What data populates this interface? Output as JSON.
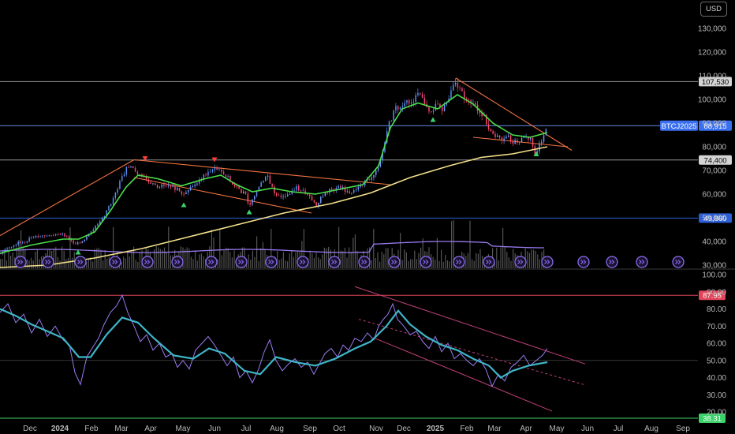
{
  "currency_button": "USD",
  "colors": {
    "background": "#000000",
    "ma_fast": "#4ade4a",
    "ma_slow": "#f3e08a",
    "trendline": "#ff7a45",
    "rsi": "#9a7af0",
    "rsi_ma": "#3fb5c8",
    "channel": "#c0407a",
    "up_marker": "#3bd26a",
    "down_marker": "#ff3b3b",
    "volume": "#9a9a9a",
    "event_badge": "#8a6cf0",
    "level_107530": "#d4d4d4",
    "level_88870": "#d4d4d4",
    "level_74400": "#d4d4d4",
    "level_49860": "#2d5fd8",
    "ticker": "#3a6ff0",
    "rsi_level_87": "#e0455a",
    "rsi_level_38": "#3bd26a"
  },
  "chart_data": [
    {
      "type": "candlestick",
      "symbol_label": "BTCJ2025",
      "currency": "USD",
      "ylim": [
        30000,
        135000
      ],
      "y_ticks": [
        "130,000",
        "120,000",
        "110,000",
        "100,000",
        "90,000",
        "80,000",
        "70,000",
        "60,000",
        "50,000",
        "40,000",
        "30,000"
      ],
      "y_tick_values": [
        130000,
        120000,
        110000,
        100000,
        90000,
        80000,
        70000,
        60000,
        50000,
        40000,
        30000
      ],
      "x_labels": [
        "Dec",
        "2024",
        "Feb",
        "Mar",
        "Apr",
        "May",
        "Jun",
        "Jul",
        "Aug",
        "Sep",
        "Oct",
        "Nov",
        "Dec",
        "2025",
        "Feb",
        "Mar",
        "Apr",
        "May",
        "Jun",
        "Jul",
        "Aug",
        "Sep"
      ],
      "close_path": [
        [
          0,
          35000
        ],
        [
          10,
          37500
        ],
        [
          20,
          39000
        ],
        [
          30,
          40000
        ],
        [
          40,
          41500
        ],
        [
          50,
          42500
        ],
        [
          60,
          42000
        ],
        [
          70,
          42500
        ],
        [
          80,
          43000
        ],
        [
          90,
          40000
        ],
        [
          100,
          39000
        ],
        [
          110,
          42000
        ],
        [
          120,
          46000
        ],
        [
          130,
          50000
        ],
        [
          140,
          56000
        ],
        [
          150,
          64000
        ],
        [
          158,
          70000
        ],
        [
          165,
          72000
        ],
        [
          172,
          70000
        ],
        [
          180,
          67000
        ],
        [
          190,
          64500
        ],
        [
          200,
          63000
        ],
        [
          210,
          64000
        ],
        [
          220,
          63000
        ],
        [
          230,
          60000
        ],
        [
          238,
          61000
        ],
        [
          245,
          64000
        ],
        [
          255,
          67000
        ],
        [
          265,
          69000
        ],
        [
          272,
          71000
        ],
        [
          280,
          70000
        ],
        [
          290,
          66500
        ],
        [
          300,
          62500
        ],
        [
          310,
          60000
        ],
        [
          316,
          55000
        ],
        [
          322,
          60000
        ],
        [
          330,
          65000
        ],
        [
          338,
          67500
        ],
        [
          345,
          62000
        ],
        [
          355,
          58000
        ],
        [
          365,
          60000
        ],
        [
          375,
          62500
        ],
        [
          385,
          62000
        ],
        [
          393,
          58000
        ],
        [
          400,
          55000
        ],
        [
          410,
          60000
        ],
        [
          420,
          62000
        ],
        [
          430,
          63000
        ],
        [
          440,
          61000
        ],
        [
          450,
          62000
        ],
        [
          460,
          64500
        ],
        [
          468,
          66000
        ],
        [
          475,
          69000
        ],
        [
          483,
          74000
        ],
        [
          488,
          84000
        ],
        [
          493,
          90000
        ],
        [
          500,
          96000
        ],
        [
          508,
          98000
        ],
        [
          515,
          100000
        ],
        [
          522,
          98000
        ],
        [
          530,
          104000
        ],
        [
          537,
          98000
        ],
        [
          545,
          95000
        ],
        [
          552,
          97500
        ],
        [
          560,
          96000
        ],
        [
          568,
          100000
        ],
        [
          575,
          106000
        ],
        [
          582,
          104000
        ],
        [
          590,
          100000
        ],
        [
          598,
          98000
        ],
        [
          605,
          96000
        ],
        [
          612,
          93000
        ],
        [
          620,
          88000
        ],
        [
          628,
          84000
        ],
        [
          635,
          83000
        ],
        [
          642,
          85000
        ],
        [
          650,
          82000
        ],
        [
          658,
          83000
        ],
        [
          665,
          85000
        ],
        [
          672,
          83500
        ],
        [
          677,
          77000
        ],
        [
          682,
          80000
        ],
        [
          688,
          85000
        ],
        [
          694,
          88000
        ]
      ],
      "ma_fast_path": [
        [
          0,
          35000
        ],
        [
          40,
          38500
        ],
        [
          80,
          41000
        ],
        [
          100,
          41000
        ],
        [
          120,
          44000
        ],
        [
          140,
          53000
        ],
        [
          160,
          63000
        ],
        [
          175,
          68000
        ],
        [
          200,
          66500
        ],
        [
          230,
          63500
        ],
        [
          260,
          66500
        ],
        [
          280,
          68000
        ],
        [
          300,
          64000
        ],
        [
          320,
          61000
        ],
        [
          345,
          62500
        ],
        [
          370,
          61000
        ],
        [
          400,
          60000
        ],
        [
          430,
          62000
        ],
        [
          460,
          64000
        ],
        [
          480,
          72000
        ],
        [
          495,
          88000
        ],
        [
          510,
          96000
        ],
        [
          530,
          98500
        ],
        [
          555,
          96000
        ],
        [
          580,
          102000
        ],
        [
          600,
          98000
        ],
        [
          625,
          90000
        ],
        [
          650,
          85000
        ],
        [
          672,
          84000
        ],
        [
          694,
          86000
        ]
      ],
      "ma_slow_path": [
        [
          0,
          29000
        ],
        [
          60,
          30000
        ],
        [
          120,
          33000
        ],
        [
          180,
          37000
        ],
        [
          240,
          42000
        ],
        [
          300,
          47000
        ],
        [
          360,
          52000
        ],
        [
          420,
          56000
        ],
        [
          470,
          60500
        ],
        [
          520,
          67000
        ],
        [
          570,
          72000
        ],
        [
          610,
          75500
        ],
        [
          650,
          77000
        ],
        [
          694,
          80000
        ]
      ],
      "horizontal_levels": [
        {
          "label": "107,530",
          "value": 107530
        },
        {
          "label": "88,870",
          "value": 88870
        },
        {
          "label": "74,400",
          "value": 74400
        },
        {
          "label": "49,860",
          "value": 49860
        }
      ],
      "current_price": {
        "label": "88,915",
        "value": 88915
      },
      "trendlines": [
        {
          "x": [
            0,
            170
          ],
          "y": [
            42500,
            74500
          ]
        },
        {
          "x": [
            170,
            495
          ],
          "y": [
            74500,
            64000
          ]
        },
        {
          "x": [
            170,
            395
          ],
          "y": [
            67000,
            52000
          ]
        },
        {
          "x": [
            578,
            725
          ],
          "y": [
            109000,
            78500
          ]
        },
        {
          "x": [
            600,
            720
          ],
          "y": [
            84000,
            80000
          ]
        }
      ],
      "markers": [
        {
          "type": "up",
          "x": 99,
          "price": 35500
        },
        {
          "type": "down",
          "x": 184,
          "price": 75000
        },
        {
          "type": "down",
          "x": 272,
          "price": 74500
        },
        {
          "type": "up",
          "x": 233,
          "price": 55500
        },
        {
          "type": "up",
          "x": 316,
          "price": 52500
        },
        {
          "type": "up",
          "x": 549,
          "price": 91500
        },
        {
          "type": "up",
          "x": 680,
          "price": 77000
        }
      ],
      "event_badges_x": [
        26,
        61,
        102,
        146,
        187,
        225,
        268,
        306,
        344,
        384,
        424,
        462,
        500,
        540,
        582,
        620,
        660,
        694,
        740,
        776,
        814,
        860
      ]
    },
    {
      "type": "line",
      "indicator": "RSI",
      "ylim": [
        20,
        100
      ],
      "y_ticks": [
        "100.00",
        "90.00",
        "80.00",
        "70.00",
        "60.00",
        "50.00",
        "40.00",
        "30.00",
        "20.00"
      ],
      "y_tick_values": [
        100,
        90,
        80,
        70,
        60,
        50,
        40,
        30,
        20
      ],
      "levels": [
        {
          "label": "87.95",
          "value": 87.95
        },
        {
          "label": "38.31",
          "value": 38.31
        }
      ],
      "rsi_path": [
        [
          0,
          78
        ],
        [
          10,
          83
        ],
        [
          20,
          72
        ],
        [
          30,
          77
        ],
        [
          40,
          66
        ],
        [
          50,
          74
        ],
        [
          60,
          64
        ],
        [
          70,
          70
        ],
        [
          80,
          62
        ],
        [
          88,
          59
        ],
        [
          95,
          43
        ],
        [
          102,
          36
        ],
        [
          110,
          52
        ],
        [
          118,
          58
        ],
        [
          125,
          63
        ],
        [
          132,
          71
        ],
        [
          140,
          78
        ],
        [
          148,
          82
        ],
        [
          155,
          88
        ],
        [
          162,
          78
        ],
        [
          170,
          70
        ],
        [
          178,
          61
        ],
        [
          186,
          65
        ],
        [
          194,
          56
        ],
        [
          202,
          60
        ],
        [
          210,
          52
        ],
        [
          218,
          54
        ],
        [
          225,
          46
        ],
        [
          232,
          50
        ],
        [
          240,
          45
        ],
        [
          248,
          56
        ],
        [
          256,
          60
        ],
        [
          264,
          64
        ],
        [
          272,
          59
        ],
        [
          280,
          53
        ],
        [
          288,
          47
        ],
        [
          296,
          52
        ],
        [
          304,
          40
        ],
        [
          312,
          44
        ],
        [
          320,
          37
        ],
        [
          328,
          45
        ],
        [
          335,
          55
        ],
        [
          342,
          62
        ],
        [
          350,
          50
        ],
        [
          358,
          44
        ],
        [
          366,
          48
        ],
        [
          374,
          51
        ],
        [
          382,
          46
        ],
        [
          390,
          49
        ],
        [
          398,
          42
        ],
        [
          405,
          48
        ],
        [
          412,
          54
        ],
        [
          420,
          57
        ],
        [
          428,
          52
        ],
        [
          435,
          59
        ],
        [
          442,
          56
        ],
        [
          450,
          63
        ],
        [
          458,
          61
        ],
        [
          466,
          66
        ],
        [
          474,
          62
        ],
        [
          480,
          70
        ],
        [
          486,
          74
        ],
        [
          492,
          77
        ],
        [
          498,
          83
        ],
        [
          504,
          74
        ],
        [
          512,
          70
        ],
        [
          520,
          65
        ],
        [
          528,
          67
        ],
        [
          536,
          61
        ],
        [
          544,
          57
        ],
        [
          552,
          64
        ],
        [
          560,
          55
        ],
        [
          568,
          60
        ],
        [
          576,
          51
        ],
        [
          584,
          54
        ],
        [
          592,
          50
        ],
        [
          600,
          47
        ],
        [
          608,
          51
        ],
        [
          616,
          45
        ],
        [
          624,
          35
        ],
        [
          632,
          42
        ],
        [
          640,
          38
        ],
        [
          648,
          46
        ],
        [
          656,
          49
        ],
        [
          664,
          53
        ],
        [
          672,
          47
        ],
        [
          680,
          50
        ],
        [
          688,
          53
        ],
        [
          694,
          57
        ]
      ],
      "rsi_ma_path": [
        [
          0,
          80
        ],
        [
          20,
          76
        ],
        [
          40,
          71
        ],
        [
          60,
          67
        ],
        [
          80,
          63
        ],
        [
          100,
          52
        ],
        [
          115,
          52
        ],
        [
          135,
          65
        ],
        [
          155,
          75
        ],
        [
          175,
          72
        ],
        [
          195,
          63
        ],
        [
          220,
          53
        ],
        [
          245,
          51
        ],
        [
          265,
          57
        ],
        [
          285,
          54
        ],
        [
          310,
          44
        ],
        [
          330,
          42
        ],
        [
          350,
          52
        ],
        [
          375,
          49
        ],
        [
          400,
          47
        ],
        [
          425,
          51
        ],
        [
          450,
          57
        ],
        [
          470,
          61
        ],
        [
          490,
          70
        ],
        [
          505,
          79
        ],
        [
          520,
          71
        ],
        [
          540,
          64
        ],
        [
          560,
          59
        ],
        [
          580,
          56
        ],
        [
          600,
          51
        ],
        [
          620,
          47
        ],
        [
          635,
          40
        ],
        [
          650,
          44
        ],
        [
          670,
          47
        ],
        [
          694,
          49
        ]
      ],
      "channel_lines": [
        {
          "x": [
            450,
            742
          ],
          "y": [
            93,
            48
          ],
          "style": "solid"
        },
        {
          "x": [
            455,
            740
          ],
          "y": [
            74,
            36
          ],
          "style": "dashed"
        },
        {
          "x": [
            475,
            700
          ],
          "y": [
            63,
            20.5
          ],
          "style": "solid"
        }
      ]
    }
  ]
}
